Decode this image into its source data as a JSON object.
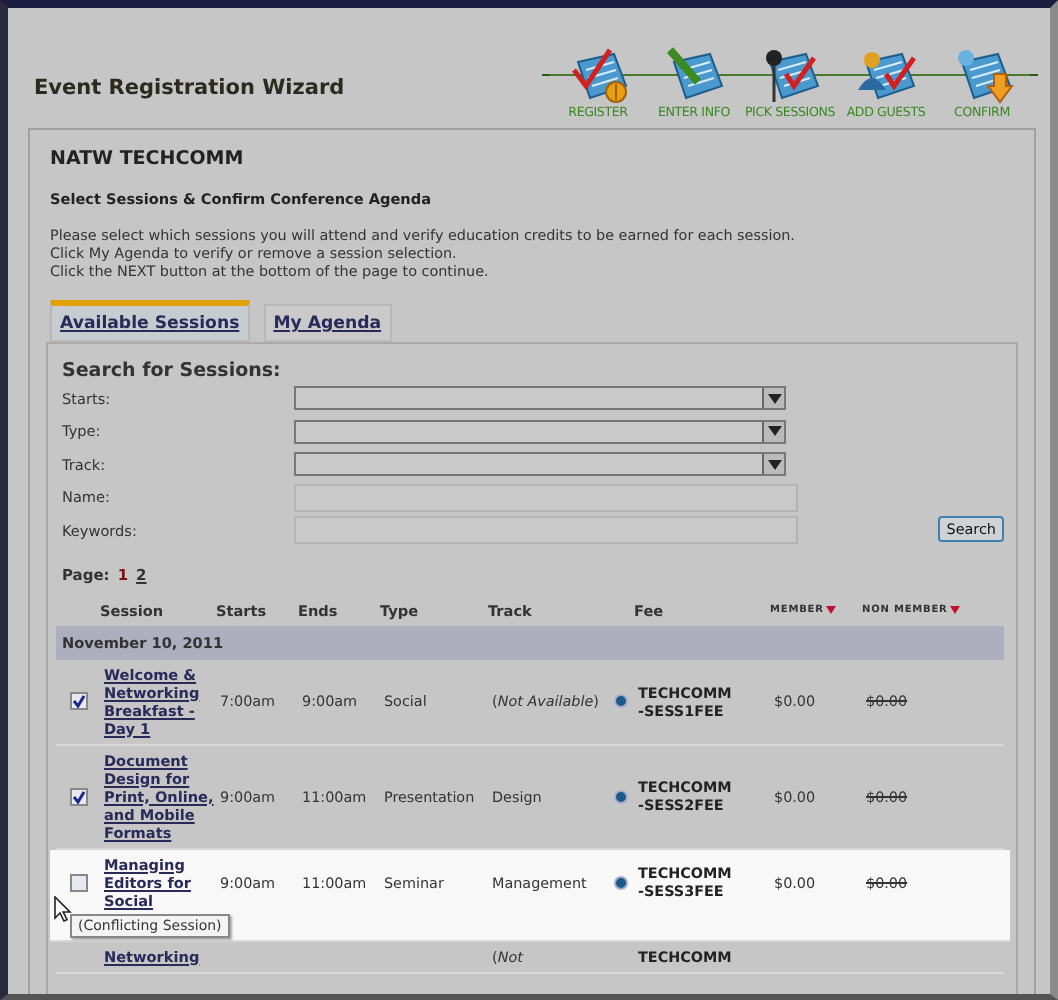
{
  "window": {
    "title": "Event Registration Wizard"
  },
  "steps": [
    {
      "label": "REGISTER",
      "kind": "register"
    },
    {
      "label": "ENTER INFO",
      "kind": "enter"
    },
    {
      "label": "PICK SESSIONS",
      "kind": "pick"
    },
    {
      "label": "ADD GUESTS",
      "kind": "guests"
    },
    {
      "label": "CONFIRM",
      "kind": "confirm"
    }
  ],
  "event": {
    "name": "NATW TECHCOMM",
    "heading": "Select Sessions & Confirm Conference Agenda",
    "instructions": [
      "Please select which sessions you will attend and verify education credits to be earned for each session.",
      "Click My Agenda to verify or remove a session selection.",
      "Click the NEXT button at the bottom of the page to continue."
    ]
  },
  "tabs": [
    {
      "label": "Available Sessions",
      "selected": true
    },
    {
      "label": "My Agenda",
      "selected": false
    }
  ],
  "search": {
    "title": "Search for Sessions:",
    "button": "Search",
    "fields": [
      {
        "label": "Starts:",
        "kind": "select"
      },
      {
        "label": "Type:",
        "kind": "select"
      },
      {
        "label": "Track:",
        "kind": "select"
      },
      {
        "label": "Name:",
        "kind": "text"
      },
      {
        "label": "Keywords:",
        "kind": "text"
      }
    ]
  },
  "pager": {
    "label": "Page:",
    "pages": [
      {
        "label": "1",
        "selected": true
      },
      {
        "label": "2",
        "selected": false
      }
    ]
  },
  "table": {
    "columns": [
      "Session",
      "Starts",
      "Ends",
      "Type",
      "Track",
      "Fee",
      "MEMBER",
      "NON MEMBER"
    ],
    "date": "November 10, 2011",
    "rows": [
      {
        "checked": true,
        "highlighted": false,
        "session": "Welcome & Networking Breakfast - Day 1",
        "starts": "7:00am",
        "ends": "9:00am",
        "type": "Social",
        "track": "(*Not Available*)",
        "fee_selected": true,
        "fee": "TECHCOMM -SESS1FEE",
        "member": "$0.00",
        "non_member": "$0.00"
      },
      {
        "checked": true,
        "highlighted": false,
        "session": "Document Design for Print, Online, and Mobile Formats",
        "starts": "9:00am",
        "ends": "11:00am",
        "type": "Presentation",
        "track": "Design",
        "fee_selected": true,
        "fee": "TECHCOMM -SESS2FEE",
        "member": "$0.00",
        "non_member": "$0.00"
      },
      {
        "checked": false,
        "highlighted": true,
        "session": "Managing Editors for Social",
        "starts": "9:00am",
        "ends": "11:00am",
        "type": "Seminar",
        "track": "Management",
        "fee_selected": true,
        "fee": "TECHCOMM -SESS3FEE",
        "member": "$0.00",
        "non_member": "$0.00",
        "tooltip": "(Conflicting Session)"
      },
      {
        "highlighted": false,
        "session": "Networking",
        "track": "(*Not*",
        "fee": "TECHCOMM"
      }
    ]
  }
}
